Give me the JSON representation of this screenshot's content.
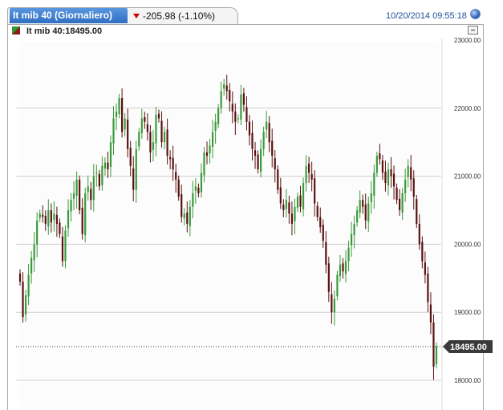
{
  "header": {
    "tab_title": "It mib 40 (Giornaliero)",
    "change": "-205.98 (-1.10%)",
    "timestamp": "10/20/2014 09:55:18",
    "colors": {
      "tab": "#3a7fd3",
      "down": "#d20000",
      "timestamp": "#1e4f98"
    }
  },
  "legend": {
    "label": "It mib 40:18495.00"
  },
  "chart_data": {
    "type": "candlestick",
    "ylim": [
      17600,
      23150
    ],
    "yticks": [
      "23000.00",
      "22000.00",
      "21000.00",
      "20000.00",
      "19000.00",
      "18000.00"
    ],
    "ytick_values": [
      23000,
      22000,
      21000,
      20000,
      19000,
      18000
    ],
    "last_price": 18495.0,
    "last_price_label": "18495.00",
    "grid": true,
    "colors": {
      "up": "#3a9a3a",
      "down": "#5a1010",
      "grid": "#cfcfcf",
      "last": "#333333"
    },
    "closes": [
      19450,
      18930,
      19250,
      19550,
      19800,
      20000,
      20350,
      20450,
      20400,
      20300,
      20500,
      20320,
      20450,
      20300,
      20150,
      19750,
      20200,
      20500,
      20650,
      20750,
      20950,
      20500,
      20150,
      20750,
      20850,
      20650,
      21000,
      21050,
      20850,
      21150,
      21200,
      21100,
      21500,
      21850,
      21950,
      22150,
      21650,
      21850,
      21400,
      21150,
      20800,
      21400,
      21650,
      21850,
      21800,
      21650,
      21350,
      21500,
      21900,
      21850,
      21500,
      21650,
      21300,
      21250,
      21100,
      20950,
      20700,
      20400,
      20450,
      20300,
      20550,
      20750,
      20850,
      20750,
      21050,
      21350,
      21300,
      21450,
      21650,
      21800,
      22000,
      22250,
      22350,
      22250,
      22100,
      21950,
      21800,
      21850,
      22200,
      22050,
      21800,
      21600,
      21400,
      21300,
      21100,
      21400,
      21650,
      21800,
      21500,
      21300,
      21100,
      20800,
      20600,
      20500,
      20650,
      20450,
      20300,
      20550,
      20700,
      20550,
      20900,
      21150,
      21050,
      20950,
      20600,
      20400,
      20250,
      20050,
      19700,
      19300,
      19000,
      19200,
      19550,
      19700,
      19600,
      19750,
      19950,
      20150,
      20300,
      20500,
      20650,
      20550,
      20350,
      20600,
      20750,
      21050,
      21300,
      21250,
      21050,
      20900,
      21100,
      21000,
      20850,
      20650,
      20500,
      20750,
      20950,
      21150,
      20950,
      20700,
      20300,
      20000,
      19750,
      19550,
      19150,
      18850,
      18200,
      18495
    ]
  }
}
